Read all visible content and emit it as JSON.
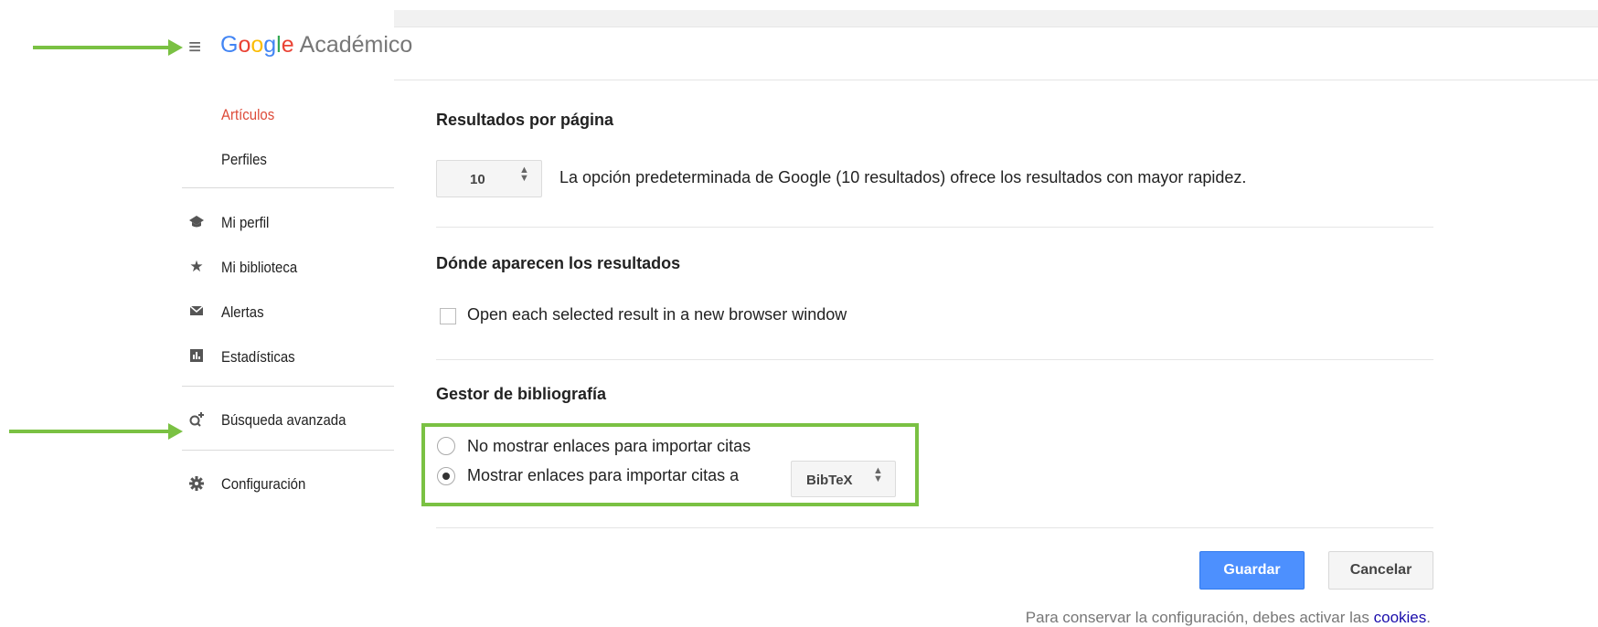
{
  "header": {
    "menu_icon": "hamburger-menu-icon",
    "logo_letters": [
      "G",
      "o",
      "o",
      "g",
      "l",
      "e"
    ],
    "product_name": "Académico"
  },
  "sidebar": {
    "items": [
      {
        "label": "Artículos",
        "active": true
      },
      {
        "label": "Perfiles"
      },
      {
        "label": "Mi perfil",
        "icon": "graduation-cap-icon"
      },
      {
        "label": "Mi biblioteca",
        "icon": "star-icon"
      },
      {
        "label": "Alertas",
        "icon": "envelope-icon"
      },
      {
        "label": "Estadísticas",
        "icon": "bar-chart-icon"
      },
      {
        "label": "Búsqueda avanzada",
        "icon": "search-plus-icon"
      },
      {
        "label": "Configuración",
        "icon": "gear-icon"
      }
    ]
  },
  "settings": {
    "results_per_page": {
      "title": "Resultados por página",
      "selected": "10",
      "description": "La opción predeterminada de Google (10 resultados) ofrece los resultados con mayor rapidez."
    },
    "where_results": {
      "title": "Dónde aparecen los resultados",
      "checkbox_label": "Open each selected result in a new browser window",
      "checked": false
    },
    "bibliography": {
      "title": "Gestor de bibliografía",
      "options": [
        {
          "label": "No mostrar enlaces para importar citas",
          "selected": false
        },
        {
          "label": "Mostrar enlaces para importar citas a",
          "selected": true
        }
      ],
      "format_selected": "BibTeX"
    }
  },
  "actions": {
    "save_label": "Guardar",
    "cancel_label": "Cancelar"
  },
  "footer": {
    "note_prefix": "Para conservar la configuración, debes activar las",
    "cookies_link": "cookies",
    "note_suffix": "."
  },
  "colors": {
    "accent_green": "#7ac143",
    "active_red": "#dd4b39",
    "primary_blue": "#4d90fe"
  }
}
